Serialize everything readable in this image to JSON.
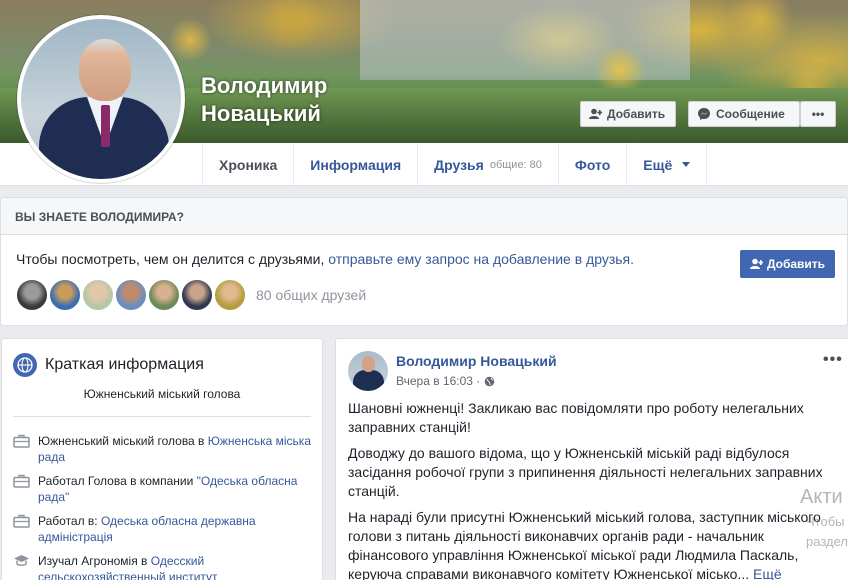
{
  "profile": {
    "first_name": "Володимир",
    "last_name": "Новацький"
  },
  "cover_actions": {
    "add_label": "Добавить",
    "message_label": "Сообщение",
    "more_label": "•••"
  },
  "nav": {
    "tabs": [
      {
        "label": "Хроника"
      },
      {
        "label": "Информация"
      },
      {
        "label": "Друзья",
        "badge": "общие: 80"
      },
      {
        "label": "Фото"
      },
      {
        "label": "Ещё"
      }
    ]
  },
  "know": {
    "header": "ВЫ ЗНАЕТЕ ВОЛОДИМИРА?",
    "text": "Чтобы посмотреть, чем он делится с друзьями,",
    "link": "отправьте ему запрос на добавление в друзья.",
    "add_button": "Добавить",
    "mutual_count": "80 общих друзей"
  },
  "intro": {
    "title": "Краткая информация",
    "bio": "Южненський міський голова",
    "items": [
      {
        "text": "Южненський міський голова в ",
        "link": "Южненська міська рада"
      },
      {
        "text": "Работал Голова в компании ",
        "link": "\"Одеська обласна рада\""
      },
      {
        "text": "Работал в: ",
        "link": "Одеська обласна державна адміністрація"
      },
      {
        "text": "Изучал Агрономія в ",
        "link": "Одесский сельскохозяйственный институт"
      }
    ]
  },
  "post": {
    "author": "Володимир Новацький",
    "time": "Вчера в 16:03 ·",
    "more": "•••",
    "p1": "Шановні южненці! Закликаю вас повідомляти про роботу нелегальних заправних станцій!",
    "p2": "Доводжу до вашого відома, що у Южненській міській раді відбулося засідання робочої групи з припинення діяльності нелегальних заправних станцій.",
    "p3": "На нараді були присутні Южненський міський голова, заступник міського голови з питань діяльності виконавчих органів ради - начальник фінансового управління Южненської міської ради Людмила Паскаль, керуюча справами виконавчого комітету Южненської місько...",
    "see_more": "Ещё"
  },
  "watermark": {
    "line1": "Акти",
    "line2": "Чтобы",
    "line3": "раздел"
  }
}
